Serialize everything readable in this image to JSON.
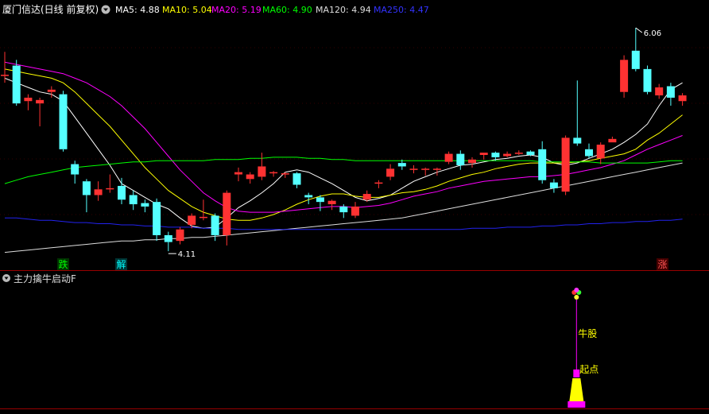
{
  "header": {
    "title": "厦门信达(日线 前复权)",
    "ma_items": [
      {
        "label": "MA5: 4.88",
        "color": "#ffffff"
      },
      {
        "label": "MA10: 5.04",
        "color": "#ffff00"
      },
      {
        "label": "MA20: 5.19",
        "color": "#ff00ff"
      },
      {
        "label": "MA60: 4.90",
        "color": "#00ff00"
      },
      {
        "label": "MA120: 4.94",
        "color": "#dddddd"
      },
      {
        "label": "MA250: 4.47",
        "color": "#3333ff"
      }
    ]
  },
  "price_panel": {
    "high_label": "6.06",
    "low_label": "4.11",
    "signals": [
      {
        "text": "跌",
        "color": "#00ff00",
        "bg": "#003300"
      },
      {
        "text": "解",
        "color": "#00ffff",
        "bg": "#003333"
      },
      {
        "text": "涨",
        "color": "#ff5555",
        "bg": "#440000"
      }
    ]
  },
  "indicator_panel": {
    "title": "主力擒牛启动F",
    "bull_label": "牛股",
    "start_label": "起点"
  },
  "chart_data": {
    "type": "candlestick",
    "ylim": [
      4.0,
      6.15
    ],
    "ohlc": [
      [
        5.65,
        5.65,
        5.85,
        5.58
      ],
      [
        5.73,
        5.4,
        5.78,
        5.38
      ],
      [
        5.42,
        5.45,
        5.48,
        5.34
      ],
      [
        5.4,
        5.43,
        5.45,
        5.2
      ],
      [
        5.5,
        5.52,
        5.55,
        5.45
      ],
      [
        5.48,
        5.0,
        5.51,
        4.98
      ],
      [
        4.87,
        4.78,
        4.9,
        4.7
      ],
      [
        4.72,
        4.6,
        4.74,
        4.45
      ],
      [
        4.6,
        4.65,
        4.72,
        4.55
      ],
      [
        4.65,
        4.66,
        4.78,
        4.62
      ],
      [
        4.68,
        4.56,
        4.75,
        4.52
      ],
      [
        4.6,
        4.52,
        4.64,
        4.47
      ],
      [
        4.53,
        4.5,
        4.56,
        4.45
      ],
      [
        4.54,
        4.25,
        4.57,
        4.2
      ],
      [
        4.25,
        4.19,
        4.28,
        4.11
      ],
      [
        4.2,
        4.3,
        4.32,
        4.17
      ],
      [
        4.34,
        4.42,
        4.44,
        4.31
      ],
      [
        4.4,
        4.41,
        4.56,
        4.38
      ],
      [
        4.42,
        4.25,
        4.44,
        4.2
      ],
      [
        4.25,
        4.62,
        4.64,
        4.16
      ],
      [
        4.78,
        4.8,
        4.84,
        4.72
      ],
      [
        4.74,
        4.78,
        4.8,
        4.7
      ],
      [
        4.76,
        4.85,
        4.97,
        4.73
      ],
      [
        4.8,
        4.8,
        4.81,
        4.76
      ],
      [
        4.78,
        4.79,
        4.8,
        4.75
      ],
      [
        4.79,
        4.69,
        4.8,
        4.66
      ],
      [
        4.6,
        4.58,
        4.62,
        4.52
      ],
      [
        4.58,
        4.54,
        4.6,
        4.46
      ],
      [
        4.52,
        4.55,
        4.56,
        4.47
      ],
      [
        4.5,
        4.45,
        4.52,
        4.4
      ],
      [
        4.42,
        4.5,
        4.54,
        4.4
      ],
      [
        4.56,
        4.61,
        4.64,
        4.54
      ],
      [
        4.7,
        4.71,
        4.73,
        4.66
      ],
      [
        4.76,
        4.83,
        4.87,
        4.73
      ],
      [
        4.88,
        4.85,
        4.91,
        4.82
      ],
      [
        4.83,
        4.83,
        4.86,
        4.79
      ],
      [
        4.82,
        4.83,
        4.84,
        4.77
      ],
      [
        4.83,
        4.83,
        4.84,
        4.77
      ],
      [
        4.89,
        4.96,
        4.98,
        4.87
      ],
      [
        4.96,
        4.86,
        4.99,
        4.82
      ],
      [
        4.88,
        4.91,
        4.93,
        4.84
      ],
      [
        4.95,
        4.97,
        4.97,
        4.91
      ],
      [
        4.97,
        4.93,
        4.98,
        4.9
      ],
      [
        4.94,
        4.96,
        4.98,
        4.93
      ],
      [
        4.96,
        4.97,
        4.99,
        4.95
      ],
      [
        4.98,
        4.95,
        4.99,
        4.94
      ],
      [
        5.0,
        4.73,
        5.07,
        4.7
      ],
      [
        4.71,
        4.66,
        4.74,
        4.62
      ],
      [
        4.63,
        5.1,
        5.12,
        4.6
      ],
      [
        5.1,
        5.05,
        5.6,
        5.03
      ],
      [
        5.0,
        4.94,
        5.05,
        4.92
      ],
      [
        4.92,
        5.04,
        5.06,
        4.87
      ],
      [
        5.06,
        5.09,
        5.11,
        5.06
      ],
      [
        5.5,
        5.78,
        5.82,
        5.45
      ],
      [
        5.86,
        5.7,
        6.06,
        5.68
      ],
      [
        5.7,
        5.5,
        5.73,
        5.48
      ],
      [
        5.47,
        5.54,
        5.57,
        5.44
      ],
      [
        5.55,
        5.45,
        5.58,
        5.38
      ],
      [
        5.42,
        5.47,
        5.49,
        5.38
      ]
    ],
    "ma_lines": [
      {
        "name": "MA5",
        "color": "#ffffff",
        "values": [
          5.62,
          5.58,
          5.54,
          5.5,
          5.48,
          5.42,
          5.28,
          5.14,
          5.0,
          4.86,
          4.7,
          4.64,
          4.58,
          4.52,
          4.48,
          4.4,
          4.33,
          4.31,
          4.32,
          4.4,
          4.49,
          4.55,
          4.62,
          4.7,
          4.8,
          4.82,
          4.8,
          4.75,
          4.7,
          4.64,
          4.58,
          4.55,
          4.57,
          4.6,
          4.66,
          4.72,
          4.76,
          4.8,
          4.83,
          4.86,
          4.87,
          4.89,
          4.91,
          4.92,
          4.94,
          4.95,
          4.93,
          4.88,
          4.86,
          4.88,
          4.92,
          4.96,
          5.0,
          5.06,
          5.13,
          5.22,
          5.38,
          5.52,
          5.58
        ]
      },
      {
        "name": "MA10",
        "color": "#ffff00",
        "values": [
          5.7,
          5.68,
          5.66,
          5.64,
          5.62,
          5.58,
          5.5,
          5.4,
          5.3,
          5.2,
          5.08,
          4.96,
          4.84,
          4.74,
          4.64,
          4.57,
          4.5,
          4.45,
          4.42,
          4.39,
          4.38,
          4.38,
          4.4,
          4.43,
          4.47,
          4.52,
          4.56,
          4.59,
          4.61,
          4.61,
          4.59,
          4.58,
          4.58,
          4.6,
          4.62,
          4.63,
          4.65,
          4.68,
          4.72,
          4.75,
          4.78,
          4.8,
          4.83,
          4.85,
          4.87,
          4.88,
          4.88,
          4.88,
          4.88,
          4.89,
          4.9,
          4.92,
          4.94,
          4.96,
          5.0,
          5.08,
          5.14,
          5.22,
          5.3
        ]
      },
      {
        "name": "MA20",
        "color": "#ff00ff",
        "values": [
          5.76,
          5.74,
          5.72,
          5.7,
          5.68,
          5.66,
          5.62,
          5.58,
          5.52,
          5.46,
          5.38,
          5.28,
          5.18,
          5.06,
          4.94,
          4.82,
          4.72,
          4.62,
          4.55,
          4.49,
          4.46,
          4.45,
          4.45,
          4.45,
          4.46,
          4.47,
          4.48,
          4.49,
          4.5,
          4.5,
          4.49,
          4.5,
          4.51,
          4.53,
          4.56,
          4.59,
          4.61,
          4.63,
          4.66,
          4.68,
          4.7,
          4.72,
          4.73,
          4.74,
          4.75,
          4.76,
          4.76,
          4.77,
          4.78,
          4.8,
          4.82,
          4.84,
          4.87,
          4.9,
          4.95,
          5.0,
          5.04,
          5.08,
          5.12
        ]
      },
      {
        "name": "MA60",
        "color": "#00ff00",
        "values": [
          4.7,
          4.73,
          4.76,
          4.78,
          4.8,
          4.82,
          4.84,
          4.85,
          4.86,
          4.87,
          4.88,
          4.89,
          4.89,
          4.9,
          4.9,
          4.9,
          4.9,
          4.9,
          4.91,
          4.91,
          4.91,
          4.92,
          4.92,
          4.93,
          4.93,
          4.93,
          4.92,
          4.92,
          4.91,
          4.91,
          4.9,
          4.9,
          4.9,
          4.9,
          4.9,
          4.9,
          4.9,
          4.9,
          4.9,
          4.9,
          4.9,
          4.9,
          4.9,
          4.9,
          4.9,
          4.9,
          4.89,
          4.89,
          4.89,
          4.89,
          4.89,
          4.88,
          4.88,
          4.88,
          4.88,
          4.88,
          4.89,
          4.9,
          4.9
        ]
      },
      {
        "name": "MA120",
        "color": "#dddddd",
        "values": [
          4.1,
          4.11,
          4.12,
          4.13,
          4.14,
          4.15,
          4.16,
          4.17,
          4.18,
          4.19,
          4.2,
          4.2,
          4.21,
          4.21,
          4.22,
          4.22,
          4.23,
          4.23,
          4.24,
          4.25,
          4.26,
          4.27,
          4.28,
          4.29,
          4.3,
          4.31,
          4.32,
          4.33,
          4.34,
          4.35,
          4.36,
          4.37,
          4.38,
          4.39,
          4.4,
          4.42,
          4.44,
          4.46,
          4.48,
          4.5,
          4.52,
          4.54,
          4.56,
          4.58,
          4.6,
          4.62,
          4.64,
          4.66,
          4.68,
          4.7,
          4.72,
          4.74,
          4.76,
          4.78,
          4.8,
          4.82,
          4.84,
          4.86,
          4.88
        ]
      },
      {
        "name": "MA250",
        "color": "#2222ee",
        "values": [
          4.4,
          4.4,
          4.39,
          4.38,
          4.38,
          4.37,
          4.36,
          4.36,
          4.35,
          4.35,
          4.34,
          4.34,
          4.33,
          4.33,
          4.32,
          4.32,
          4.32,
          4.31,
          4.31,
          4.31,
          4.3,
          4.3,
          4.3,
          4.3,
          4.3,
          4.3,
          4.3,
          4.3,
          4.3,
          4.3,
          4.3,
          4.3,
          4.3,
          4.3,
          4.3,
          4.3,
          4.3,
          4.3,
          4.3,
          4.3,
          4.31,
          4.31,
          4.31,
          4.32,
          4.32,
          4.32,
          4.33,
          4.33,
          4.34,
          4.34,
          4.35,
          4.35,
          4.36,
          4.36,
          4.37,
          4.37,
          4.38,
          4.38,
          4.39
        ]
      }
    ],
    "indicator_signal": {
      "bar_index": 49,
      "dots": [
        "#ff3333",
        "#33ff33",
        "#ffff33",
        "#ff33ff"
      ]
    }
  }
}
